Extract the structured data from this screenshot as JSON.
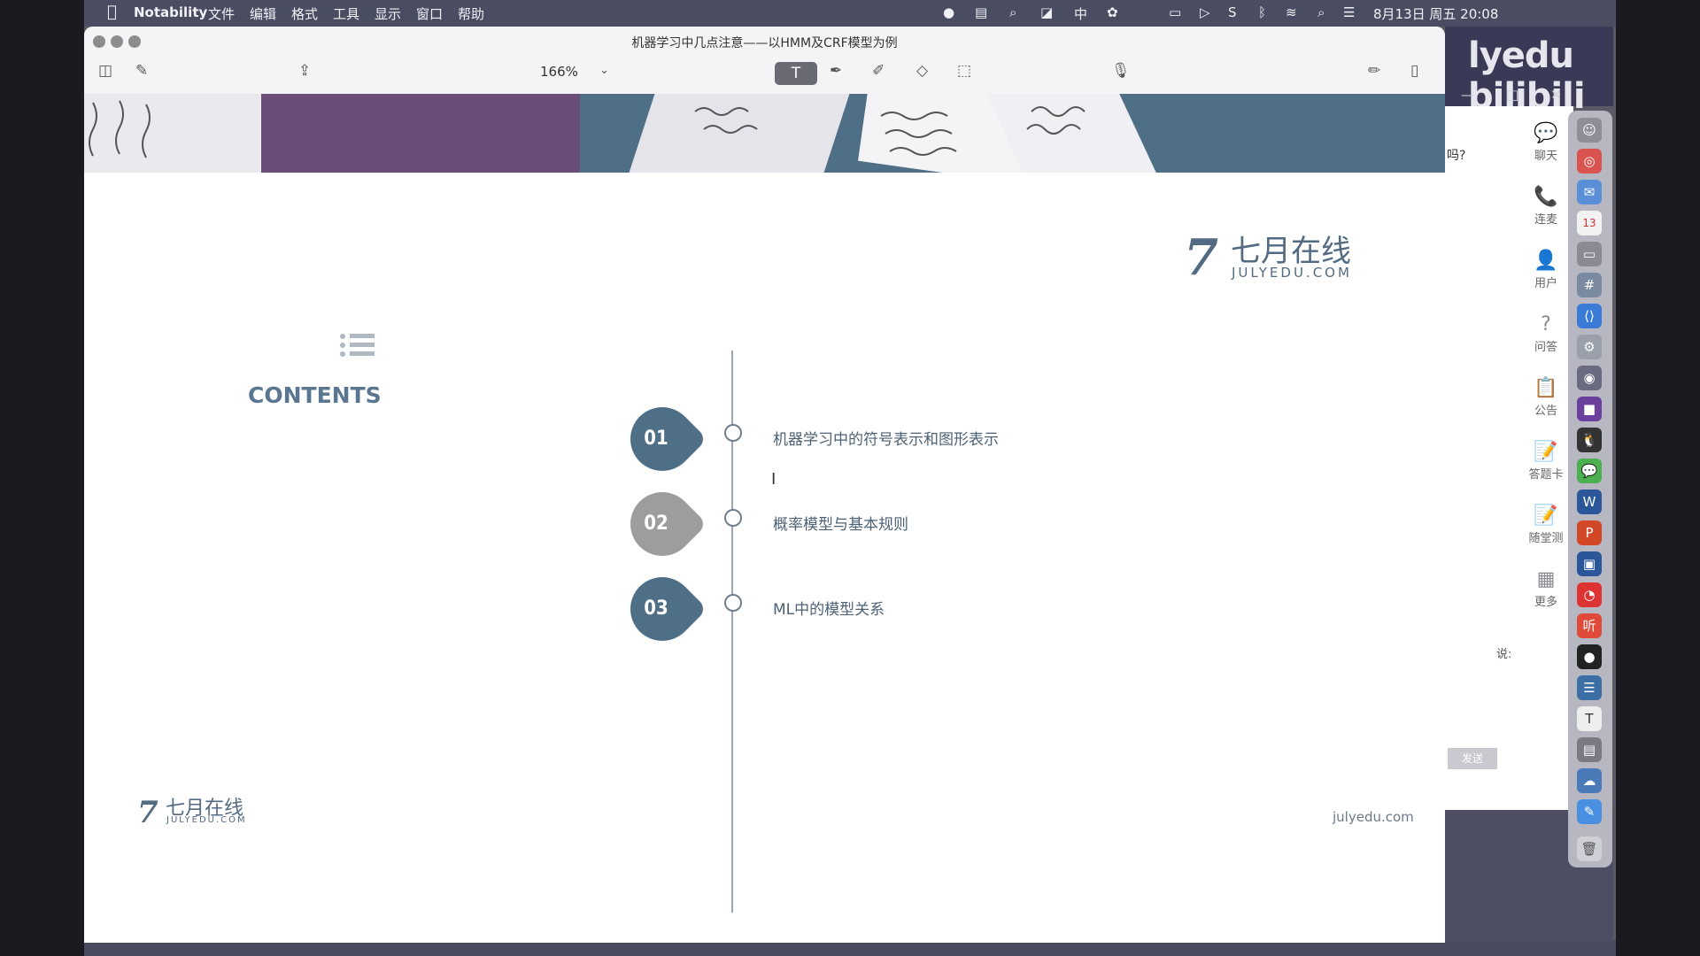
{
  "menubar": {
    "app": "Notability",
    "items": [
      "文件",
      "编辑",
      "格式",
      "工具",
      "显示",
      "窗口",
      "帮助"
    ],
    "status_input": "中",
    "clock": "8月13日 周五 20:08"
  },
  "window": {
    "title": "机器学习中几点注意——以HMM及CRF模型为例",
    "zoom": "166%"
  },
  "toolbar": {
    "text_tool": "T"
  },
  "slide": {
    "logo_cn": "七月在线",
    "logo_en": "JULYEDU.COM",
    "logo_mark": "7",
    "contents_title": "CONTENTS",
    "items": [
      {
        "num": "01",
        "label": "机器学习中的符号表示和图形表示",
        "color": "#4f6f86"
      },
      {
        "num": "02",
        "label": "概率模型与基本规则",
        "color": "#9d9d9d"
      },
      {
        "num": "03",
        "label": "ML中的模型关系",
        "color": "#4f6f86"
      }
    ],
    "footer_logo_cn": "七月在线",
    "footer_logo_en": "JULYEDU.COM",
    "footer_url": "julyedu.com"
  },
  "side_panel": {
    "watermark": "lyedu bilibili",
    "question": "吗?",
    "nav": [
      {
        "icon": "chat-icon",
        "glyph": "💬",
        "label": "聊天"
      },
      {
        "icon": "phone-icon",
        "glyph": "📞",
        "label": "连麦"
      },
      {
        "icon": "user-icon",
        "glyph": "👤",
        "label": "用户"
      },
      {
        "icon": "question-icon",
        "glyph": "?",
        "label": "问答"
      },
      {
        "icon": "notice-icon",
        "glyph": "📋",
        "label": "公告"
      },
      {
        "icon": "answer-card-icon",
        "glyph": "📝",
        "label": "答题卡"
      },
      {
        "icon": "quiz-icon",
        "glyph": "📝",
        "label": "随堂测"
      },
      {
        "icon": "more-icon",
        "glyph": "▦",
        "label": "更多"
      }
    ],
    "say": "说:",
    "send": "发送"
  },
  "colors": {
    "accent": "#4f6f86",
    "secondary": "#9d9d9d",
    "text": "#4e6276"
  }
}
